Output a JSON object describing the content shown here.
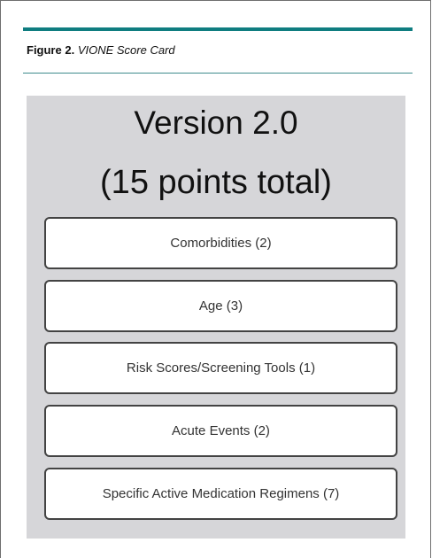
{
  "figure": {
    "label": "Figure 2.",
    "title": "VIONE Score Card"
  },
  "card": {
    "version": "Version 2.0",
    "points": "(15 points total)",
    "items": [
      {
        "label": "Comorbidities (2)"
      },
      {
        "label": "Age (3)"
      },
      {
        "label": "Risk Scores/Screening Tools (1)"
      },
      {
        "label": "Acute Events (2)"
      },
      {
        "label": "Specific Active Medication Regimens (7)"
      }
    ]
  },
  "colors": {
    "accent_rule": "#0f7d80",
    "card_background": "#d6d6d9",
    "box_border": "#434343"
  }
}
